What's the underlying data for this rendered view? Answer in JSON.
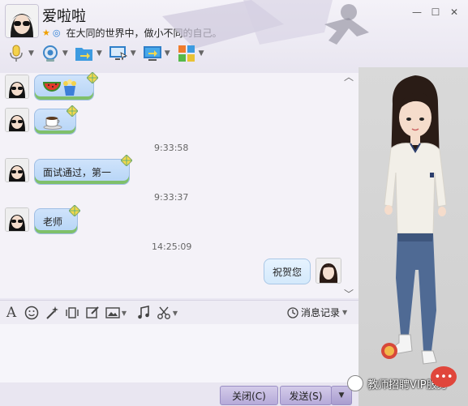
{
  "contact": {
    "name": "爱啦啦",
    "signature": "在大同的世界中，做小不同的自己。"
  },
  "window_controls": [
    "—",
    "☐",
    "✕"
  ],
  "toolbar": {
    "items": [
      {
        "icon": "microphone-icon"
      },
      {
        "icon": "webcam-icon"
      },
      {
        "icon": "file-transfer-icon"
      },
      {
        "icon": "remote-desktop-icon"
      },
      {
        "icon": "share-screen-icon"
      },
      {
        "icon": "app-grid-icon"
      }
    ]
  },
  "messages": {
    "m1_icons": [
      "watermelon-icon",
      "popcorn-icon"
    ],
    "m2_icons": [
      "coffee-icon"
    ],
    "time1": "9:33:58",
    "m3_text": "面试通过，第一",
    "time2": "9:33:37",
    "m4_text": "老师",
    "time3": "14:25:09",
    "m5_text": "祝贺您"
  },
  "input_bar": {
    "history_label": "消息记录"
  },
  "buttons": {
    "close": "关闭(C)",
    "send": "发送(S)"
  },
  "credit": "教师招聘VIP服务",
  "colors": {
    "accent": "#b6aad9",
    "bubble": "#cfe3fb",
    "bubble_border": "#9fbee4"
  }
}
